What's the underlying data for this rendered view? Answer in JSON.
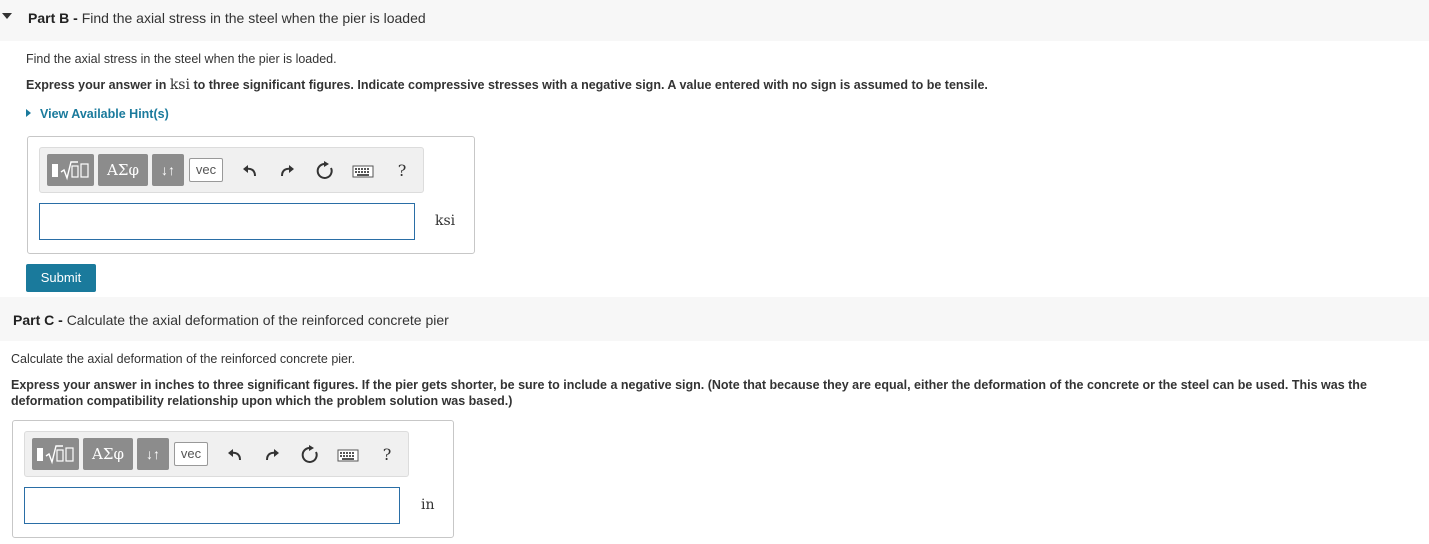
{
  "partB": {
    "header_label": "Part B -",
    "header_title": "Find the axial stress in the steel when the pier is loaded",
    "question": "Find the axial stress in the steel when the pier is loaded.",
    "instruction_prefix": "Express your answer in ",
    "instruction_unit": "ksi",
    "instruction_suffix": " to three significant figures. Indicate compressive stresses with a negative sign.  A value entered with no sign is assumed to be tensile.",
    "hint_label": "View Available Hint(s)",
    "answer_value": "",
    "unit": "ksi",
    "submit_label": "Submit"
  },
  "partC": {
    "header_label": "Part C -",
    "header_title": "Calculate the axial deformation of the reinforced concrete pier",
    "question": "Calculate the axial deformation of the reinforced concrete pier.",
    "instruction_line1": "Express your answer in inches to three significant figures. If the pier gets shorter, be sure to include a negative sign. (Note that because they are equal, either the deformation of the concrete or the steel can be used. This was the",
    "instruction_line2": "deformation compatibility relationship upon which the problem solution was based.)",
    "answer_value": "",
    "unit": "in"
  },
  "toolbar": {
    "greek_label": "ΑΣφ",
    "sort_label": "↓↑",
    "vec_label": "vec",
    "help_label": "?",
    "icons": [
      "templates-icon",
      "undo-icon",
      "redo-icon",
      "reset-icon",
      "keyboard-icon",
      "help-icon"
    ]
  }
}
